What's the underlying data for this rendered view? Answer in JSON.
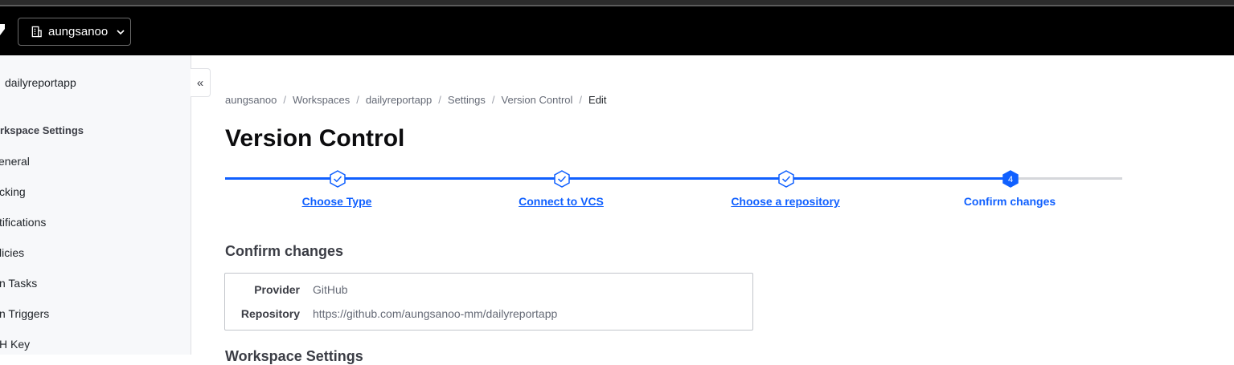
{
  "header": {
    "org_name": "aungsanoo",
    "icons": {
      "org": "building-icon",
      "dropdown": "chevron-down-icon"
    }
  },
  "sidebar": {
    "workspace_name": "dailyreportapp",
    "collapse_glyph": "«",
    "section_title": "orkspace Settings",
    "items": [
      {
        "label": "eneral"
      },
      {
        "label": "cking"
      },
      {
        "label": "tifications"
      },
      {
        "label": "licies"
      },
      {
        "label": "n Tasks"
      },
      {
        "label": "n Triggers"
      },
      {
        "label": "H Key"
      }
    ]
  },
  "breadcrumb": [
    {
      "label": "aungsanoo"
    },
    {
      "label": "Workspaces"
    },
    {
      "label": "dailyreportapp"
    },
    {
      "label": "Settings"
    },
    {
      "label": "Version Control"
    },
    {
      "label": "Edit"
    }
  ],
  "page": {
    "title": "Version Control"
  },
  "stepper": {
    "steps": [
      {
        "label": "Choose Type",
        "status": "complete"
      },
      {
        "label": "Connect to VCS",
        "status": "complete"
      },
      {
        "label": "Choose a repository",
        "status": "complete"
      },
      {
        "label": "Confirm changes",
        "status": "current",
        "number": "4"
      }
    ],
    "accent": "#1060ff"
  },
  "confirm": {
    "heading": "Confirm changes",
    "rows": [
      {
        "key": "Provider",
        "value": "GitHub"
      },
      {
        "key": "Repository",
        "value": "https://github.com/aungsanoo-mm/dailyreportapp"
      }
    ]
  },
  "next_section": {
    "heading": "Workspace Settings"
  }
}
